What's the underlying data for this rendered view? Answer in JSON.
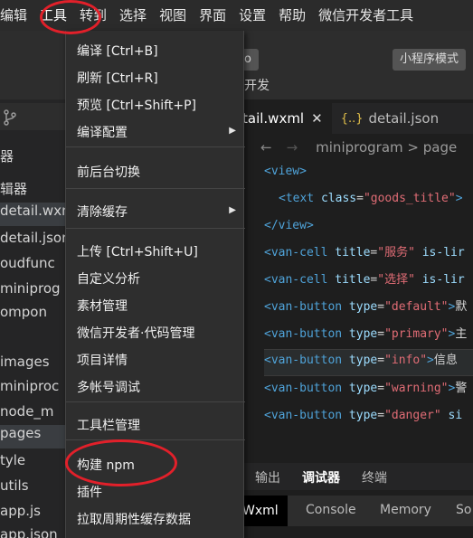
{
  "menubar": {
    "items": [
      "编辑",
      "工具",
      "转到",
      "选择",
      "视图",
      "界面",
      "设置",
      "帮助",
      "微信开发者工具"
    ]
  },
  "toolbar": {
    "mode_button": "小程序模式",
    "left_button": "o",
    "label": "开发"
  },
  "sidebar": {
    "rows": [
      "器",
      "辑器",
      "detail.wxml",
      "detail.json",
      "oudfunc",
      "miniprog",
      "ompon",
      "images",
      "miniproc",
      "node_m",
      "pages",
      "tyle",
      "utils",
      "app.js",
      "app.json"
    ]
  },
  "editor": {
    "tabs": [
      {
        "label": "tail.wxml",
        "close": "✕"
      },
      {
        "label": "detail.json",
        "icon": "{..}"
      }
    ],
    "breadcrumb": "miniprogram > page",
    "code": [
      {
        "tag": "<view>"
      },
      {
        "tag": "<text",
        "attr": "class",
        "value": "\"goods_title\"",
        "tail": ">"
      },
      {
        "tag": "</view>"
      },
      {
        "tag": "<van-cell",
        "attr": "title",
        "value": "\"服务\"",
        "tail": "is-lir"
      },
      {
        "tag": "<van-cell",
        "attr": "title",
        "value": "\"选择\"",
        "tail": "is-lir"
      },
      {
        "tag": "<van-button",
        "attr": "type",
        "value": "\"default\"",
        "tail": "默"
      },
      {
        "tag": "<van-button",
        "attr": "type",
        "value": "\"primary\"",
        "tail": "主"
      },
      {
        "tag": "<van-button",
        "attr": "type",
        "value": "\"info\"",
        "tail": "信息"
      },
      {
        "tag": "<van-button",
        "attr": "type",
        "value": "\"warning\"",
        "tail": "警"
      },
      {
        "tag": "<van-button",
        "attr": "type",
        "value": "\"danger\"",
        "tail": "si"
      }
    ]
  },
  "panel": {
    "tabs": [
      "输出",
      "调试器",
      "终端"
    ],
    "devtools": [
      "Wxml",
      "Console",
      "Memory",
      "So"
    ]
  },
  "menu": {
    "items": [
      {
        "label": "编译  [Ctrl+B]"
      },
      {
        "label": "刷新  [Ctrl+R]"
      },
      {
        "label": "预览  [Ctrl+Shift+P]"
      },
      {
        "label": "编译配置",
        "submenu": "▶"
      },
      {
        "label": "前后台切换"
      },
      {
        "label": "清除缓存",
        "submenu": "▶"
      },
      {
        "label": "上传  [Ctrl+Shift+U]"
      },
      {
        "label": "自定义分析"
      },
      {
        "label": "素材管理"
      },
      {
        "label": "微信开发者·代码管理"
      },
      {
        "label": "项目详情"
      },
      {
        "label": "多帐号调试"
      },
      {
        "label": "工具栏管理"
      },
      {
        "label": "构建 npm"
      },
      {
        "label": "插件"
      },
      {
        "label": "拉取周期性缓存数据"
      }
    ]
  },
  "colors": {
    "highlight_ring": "#e2202a",
    "menu_bg": "#2e2e2e",
    "tag": "#4fa3d9",
    "string": "#e06c75"
  }
}
